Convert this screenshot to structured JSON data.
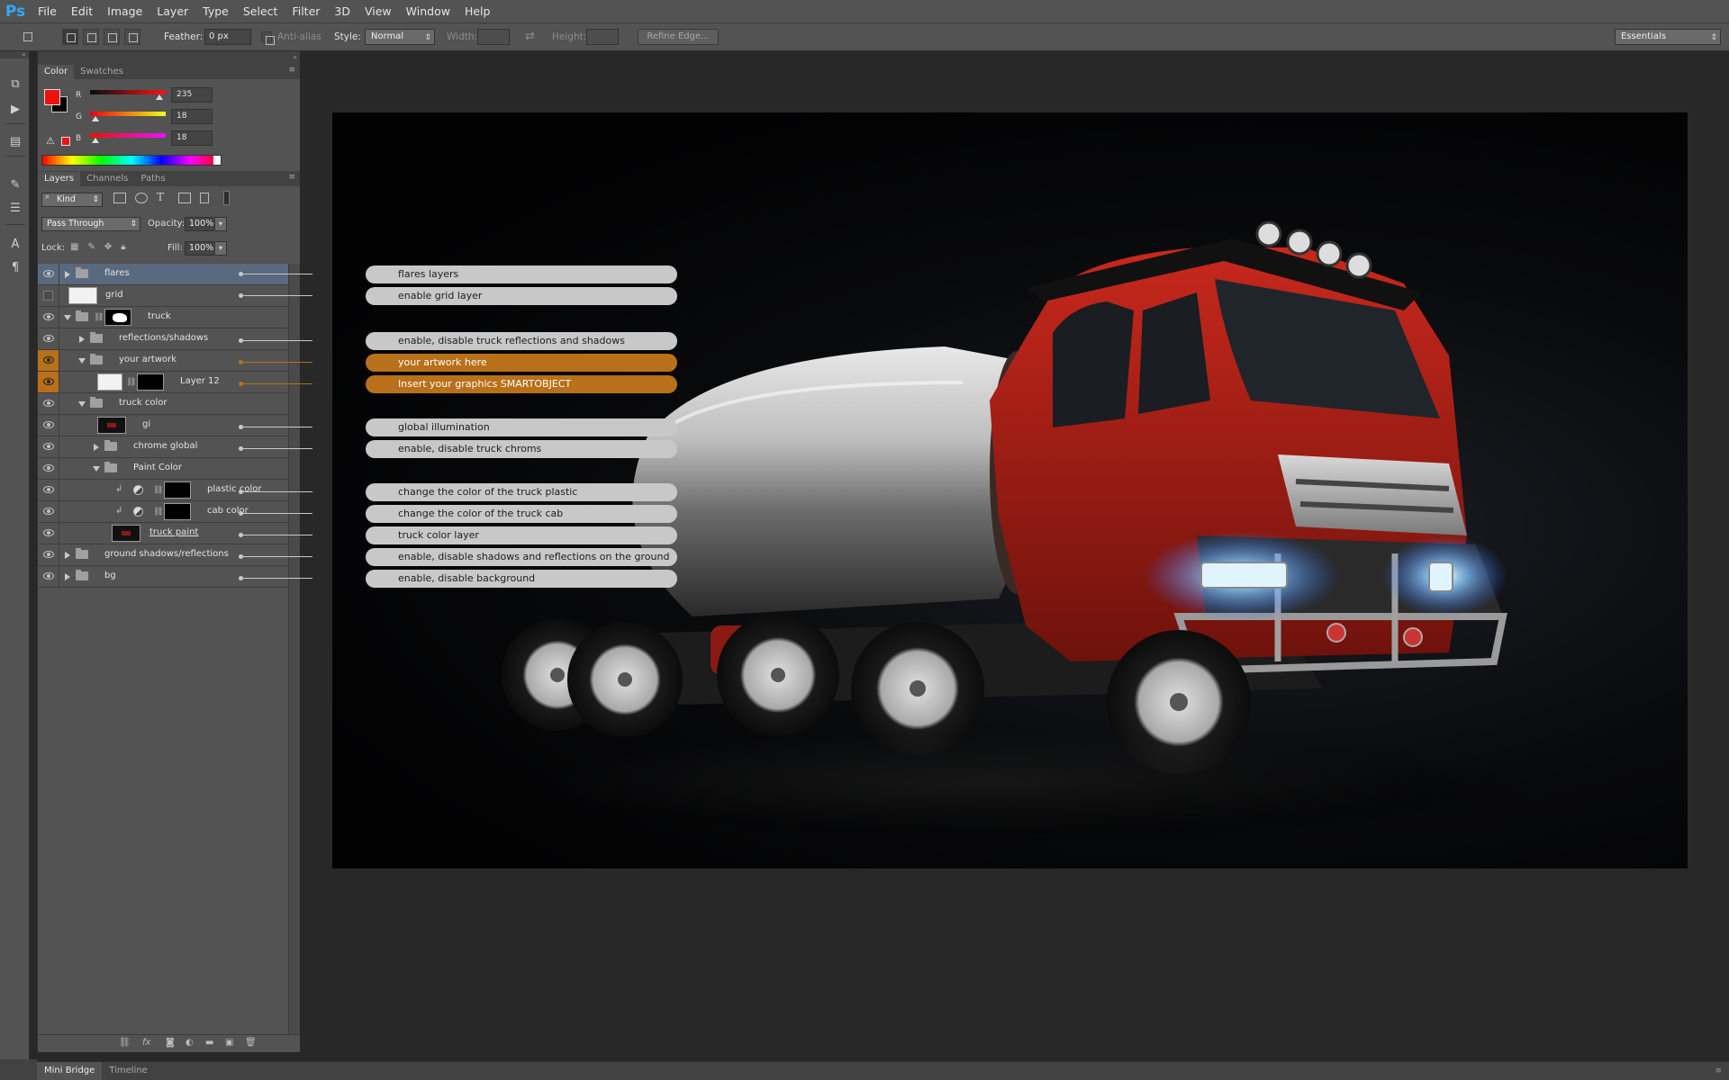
{
  "app": {
    "logo": "Ps"
  },
  "menu": [
    "File",
    "Edit",
    "Image",
    "Layer",
    "Type",
    "Select",
    "Filter",
    "3D",
    "View",
    "Window",
    "Help"
  ],
  "options": {
    "feather_label": "Feather:",
    "feather_value": "0 px",
    "antialias_label": "Anti-alias",
    "style_label": "Style:",
    "style_value": "Normal",
    "width_label": "Width:",
    "height_label": "Height:",
    "refine_edge": "Refine Edge...",
    "workspace": "Essentials"
  },
  "color_panel": {
    "tabs": [
      "Color",
      "Swatches"
    ],
    "foreground": "#eb1212",
    "background": "#000000",
    "r_label": "R",
    "g_label": "G",
    "b_label": "B",
    "r_value": "235",
    "g_value": "18",
    "b_value": "18"
  },
  "layers_panel": {
    "tabs": [
      "Layers",
      "Channels",
      "Paths"
    ],
    "kind_filter": "Kind",
    "blend_mode": "Pass Through",
    "opacity_label": "Opacity:",
    "opacity_value": "100%",
    "lock_label": "Lock:",
    "fill_label": "Fill:",
    "fill_value": "100%",
    "layers": [
      {
        "name": "flares",
        "type": "group",
        "visible": true,
        "expanded": false,
        "selected": true
      },
      {
        "name": "grid",
        "type": "layer",
        "visible": false
      },
      {
        "name": "truck",
        "type": "group",
        "visible": true,
        "expanded": true
      },
      {
        "name": "reflections/shadows",
        "type": "group",
        "visible": true,
        "expanded": false
      },
      {
        "name": "your artwork",
        "type": "group",
        "visible": true,
        "expanded": true,
        "highlight": true
      },
      {
        "name": "Layer 12",
        "type": "smart-object",
        "visible": true,
        "highlight": true
      },
      {
        "name": "truck color",
        "type": "group",
        "visible": true,
        "expanded": true
      },
      {
        "name": "gi",
        "type": "layer",
        "visible": true
      },
      {
        "name": "chrome global",
        "type": "group",
        "visible": true,
        "expanded": false
      },
      {
        "name": "Paint Color",
        "type": "group",
        "visible": true,
        "expanded": true
      },
      {
        "name": "plastic color",
        "type": "adjustment",
        "visible": true
      },
      {
        "name": "cab color",
        "type": "adjustment",
        "visible": true
      },
      {
        "name": "truck paint",
        "type": "layer",
        "visible": true
      },
      {
        "name": "ground shadows/reflections",
        "type": "group",
        "visible": true,
        "expanded": false
      },
      {
        "name": "bg",
        "type": "group",
        "visible": true,
        "expanded": false
      }
    ]
  },
  "callouts": [
    {
      "text": "flares layers",
      "style": "gray"
    },
    {
      "text": "enable grid layer",
      "style": "gray"
    },
    {
      "text": "enable, disable truck reflections and shadows",
      "style": "gray"
    },
    {
      "text": "your artwork here",
      "style": "orange"
    },
    {
      "text": "Insert your graphics  SMARTOBJECT",
      "style": "orange"
    },
    {
      "text": "global illumination",
      "style": "gray"
    },
    {
      "text": "enable, disable truck chroms",
      "style": "gray"
    },
    {
      "text": "change the color of the truck plastic",
      "style": "gray"
    },
    {
      "text": "change the color of the truck cab",
      "style": "gray"
    },
    {
      "text": "truck color layer",
      "style": "gray"
    },
    {
      "text": "enable, disable shadows and reflections on the ground",
      "style": "gray"
    },
    {
      "text": "enable, disable background",
      "style": "gray"
    }
  ],
  "canvas_image": "red-cement-mixer-truck-on-dark-background",
  "bottom_tabs": [
    "Mini Bridge",
    "Timeline"
  ],
  "colors": {
    "accent_orange": "#b8701a",
    "panel": "#535353",
    "canvas_bg": "#282828",
    "selection": "#596a7e"
  }
}
